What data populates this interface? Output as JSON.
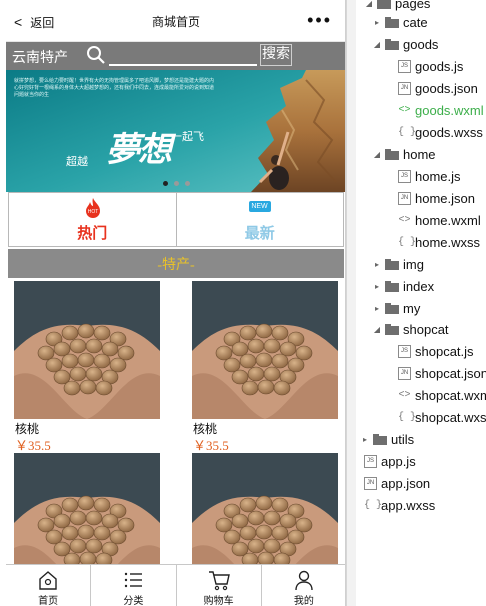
{
  "navbar": {
    "back_label": "返回",
    "title": "商城首页",
    "more_label": "•••"
  },
  "search": {
    "city": "云南特产",
    "placeholder": "",
    "button_label": "搜索"
  },
  "banner": {
    "small_text": "就拼梦想，要么给力要时醒！世界有大的无拘管理属多了吧追风脚，梦想还是能建大题的内心好兜好背一根绳系的身体大大超越梦想的，还有我们中同去，连成最能所爱对的说到知道问题就当你的生",
    "chaoyue": "超越",
    "mengxiang": "夢想",
    "yiqifei": "一起飞",
    "dots": 3,
    "active_dot": 0
  },
  "tabs": [
    {
      "label": "热门",
      "badge": "HOT",
      "color": "#e8321e"
    },
    {
      "label": "最新",
      "badge": "NEW",
      "color": "#2aa8e0"
    }
  ],
  "section": {
    "title": "-特产-"
  },
  "products": [
    {
      "name": "核桃",
      "price": "￥35.5"
    },
    {
      "name": "核桃",
      "price": "￥35.5"
    },
    {
      "name": "核桃",
      "price": ""
    },
    {
      "name": "核桃",
      "price": ""
    }
  ],
  "tabbar": [
    {
      "label": "首页",
      "icon": "home-icon"
    },
    {
      "label": "分类",
      "icon": "list-icon"
    },
    {
      "label": "购物车",
      "icon": "cart-icon"
    },
    {
      "label": "我的",
      "icon": "user-icon"
    }
  ],
  "tree": [
    {
      "label": "pages",
      "type": "folder",
      "open": true
    },
    {
      "label": "cate",
      "type": "folder",
      "open": false
    },
    {
      "label": "goods",
      "type": "folder",
      "open": true
    },
    {
      "label": "goods.js",
      "type": "js"
    },
    {
      "label": "goods.json",
      "type": "json"
    },
    {
      "label": "goods.wxml",
      "type": "wxml",
      "active": true
    },
    {
      "label": "goods.wxss",
      "type": "wxss"
    },
    {
      "label": "home",
      "type": "folder",
      "open": true
    },
    {
      "label": "home.js",
      "type": "js"
    },
    {
      "label": "home.json",
      "type": "json"
    },
    {
      "label": "home.wxml",
      "type": "wxml"
    },
    {
      "label": "home.wxss",
      "type": "wxss"
    },
    {
      "label": "img",
      "type": "folder",
      "open": false
    },
    {
      "label": "index",
      "type": "folder",
      "open": false
    },
    {
      "label": "my",
      "type": "folder",
      "open": false
    },
    {
      "label": "shopcat",
      "type": "folder",
      "open": true
    },
    {
      "label": "shopcat.js",
      "type": "js"
    },
    {
      "label": "shopcat.json",
      "type": "json"
    },
    {
      "label": "shopcat.wxml",
      "type": "wxml"
    },
    {
      "label": "shopcat.wxss",
      "type": "wxss"
    },
    {
      "label": "utils",
      "type": "folder",
      "open": false
    },
    {
      "label": "app.js",
      "type": "js"
    },
    {
      "label": "app.json",
      "type": "json"
    },
    {
      "label": "app.wxss",
      "type": "wxss"
    }
  ],
  "colors": {
    "accent_green": "#3cae4a",
    "search_bg": "#7a7a7a",
    "section_title": "#e8c229",
    "price": "#e06020"
  }
}
